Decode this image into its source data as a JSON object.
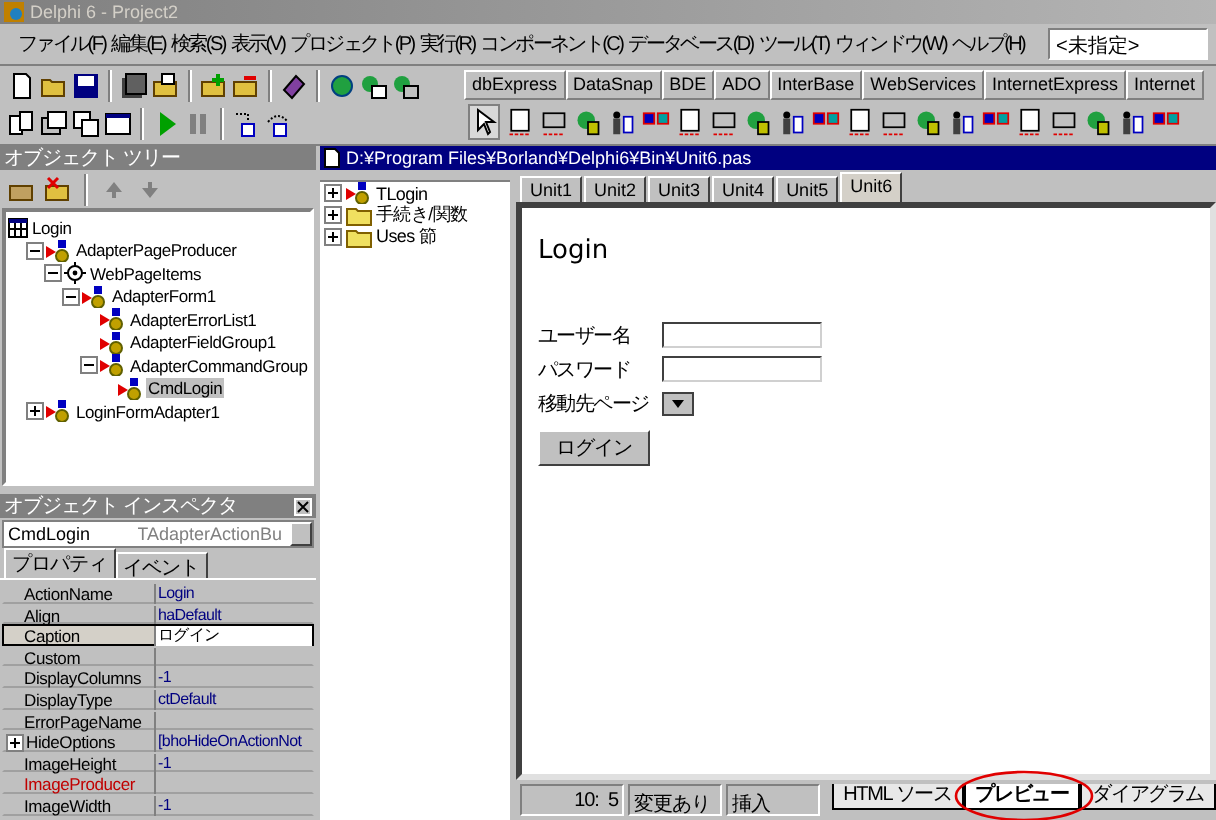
{
  "window": {
    "title": "Delphi 6 - Project2"
  },
  "menu": [
    "ファイル(F)",
    "編集(E)",
    "検索(S)",
    "表示(V)",
    "プロジェクト(P)",
    "実行(R)",
    "コンポーネント(C)",
    "データベース(D)",
    "ツール(T)",
    "ウィンドウ(W)",
    "ヘルプ(H)"
  ],
  "desktop_combo": {
    "value": "<未指定>"
  },
  "palette": {
    "tabs": [
      "dbExpress",
      "DataSnap",
      "BDE",
      "ADO",
      "InterBase",
      "WebServices",
      "InternetExpress",
      "Internet"
    ]
  },
  "object_tree": {
    "title": "オブジェクト ツリー",
    "nodes": [
      {
        "label": "Login",
        "kind": "form",
        "selected": false,
        "children": [
          {
            "label": "AdapterPageProducer",
            "kind": "component",
            "expanded": true,
            "selected": false,
            "children": [
              {
                "label": "WebPageItems",
                "kind": "items",
                "expanded": true,
                "selected": false,
                "children": [
                  {
                    "label": "AdapterForm1",
                    "kind": "component",
                    "expanded": true,
                    "selected": false,
                    "children": [
                      {
                        "label": "AdapterErrorList1",
                        "kind": "component",
                        "selected": false
                      },
                      {
                        "label": "AdapterFieldGroup1",
                        "kind": "component",
                        "selected": false
                      },
                      {
                        "label": "AdapterCommandGroup",
                        "kind": "component",
                        "expanded": true,
                        "selected": false,
                        "children": [
                          {
                            "label": "CmdLogin",
                            "kind": "component",
                            "selected": true
                          }
                        ]
                      }
                    ]
                  }
                ]
              }
            ]
          },
          {
            "label": "LoginFormAdapter1",
            "kind": "component",
            "expanded": false,
            "selected": false
          }
        ]
      }
    ]
  },
  "inspector": {
    "title": "オブジェクト インスペクタ",
    "object": "CmdLogin",
    "type": "TAdapterActionBu",
    "tabs": [
      {
        "label": "プロパティ",
        "selected": true
      },
      {
        "label": "イベント",
        "selected": false
      }
    ],
    "properties": [
      {
        "name": "ActionName",
        "value": "Login",
        "kind": "plain",
        "selected": false
      },
      {
        "name": "Align",
        "value": "haDefault",
        "kind": "plain",
        "selected": false
      },
      {
        "name": "Caption",
        "value": "ログイン",
        "kind": "plain",
        "selected": true
      },
      {
        "name": "Custom",
        "kind": "plain",
        "selected": false
      },
      {
        "name": "DisplayColumns",
        "value": "-1",
        "kind": "plain",
        "selected": false
      },
      {
        "name": "DisplayType",
        "value": "ctDefault",
        "kind": "plain",
        "selected": false
      },
      {
        "name": "ErrorPageName",
        "kind": "plain",
        "selected": false
      },
      {
        "name": "HideOptions",
        "value": "[bhoHideOnActionNot",
        "kind": "set",
        "selected": false
      },
      {
        "name": "ImageHeight",
        "value": "-1",
        "kind": "plain",
        "selected": false
      },
      {
        "name": "ImageProducer",
        "kind": "reference",
        "selected": false
      },
      {
        "name": "ImageWidth",
        "value": "-1",
        "kind": "plain",
        "selected": false
      }
    ]
  },
  "editor": {
    "path": "D:¥Program Files¥Borland¥Delphi6¥Bin¥Unit6.pas",
    "explorer": [
      {
        "label": "TLogin",
        "kind": "class"
      },
      {
        "label": "手続き/関数",
        "kind": "folder"
      },
      {
        "label": "Uses 節",
        "kind": "folder"
      }
    ],
    "tabs": [
      {
        "label": "Unit1",
        "selected": false
      },
      {
        "label": "Unit2",
        "selected": false
      },
      {
        "label": "Unit3",
        "selected": false
      },
      {
        "label": "Unit4",
        "selected": false
      },
      {
        "label": "Unit5",
        "selected": false
      },
      {
        "label": "Unit6",
        "selected": true
      }
    ],
    "preview": {
      "heading": "Login",
      "fields": [
        {
          "label": "ユーザー名",
          "kind": "text"
        },
        {
          "label": "パスワード",
          "kind": "text"
        },
        {
          "label": "移動先ページ",
          "kind": "select"
        }
      ],
      "button": "ログイン"
    },
    "status": {
      "position": "10:  5",
      "modified": "変更あり",
      "mode": "挿入"
    },
    "view_tabs": [
      {
        "label": "HTML ソース",
        "selected": false
      },
      {
        "label": "プレビュー",
        "selected": true
      },
      {
        "label": "ダイアグラム",
        "selected": false
      }
    ]
  }
}
